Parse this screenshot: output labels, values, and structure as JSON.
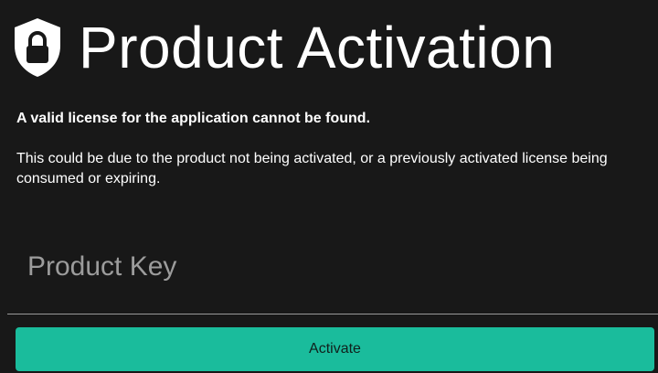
{
  "header": {
    "icon": "shield-lock-icon",
    "title": "Product Activation"
  },
  "message": {
    "headline": "A valid license for the application cannot be found.",
    "detail": "This could be due to the product not being activated, or a previously activated license being consumed or expiring."
  },
  "form": {
    "product_key_placeholder": "Product Key",
    "product_key_value": "",
    "activate_label": "Activate"
  },
  "colors": {
    "background": "#181818",
    "text": "#ffffff",
    "accent": "#1abc9c",
    "placeholder": "#9c9c9c"
  }
}
